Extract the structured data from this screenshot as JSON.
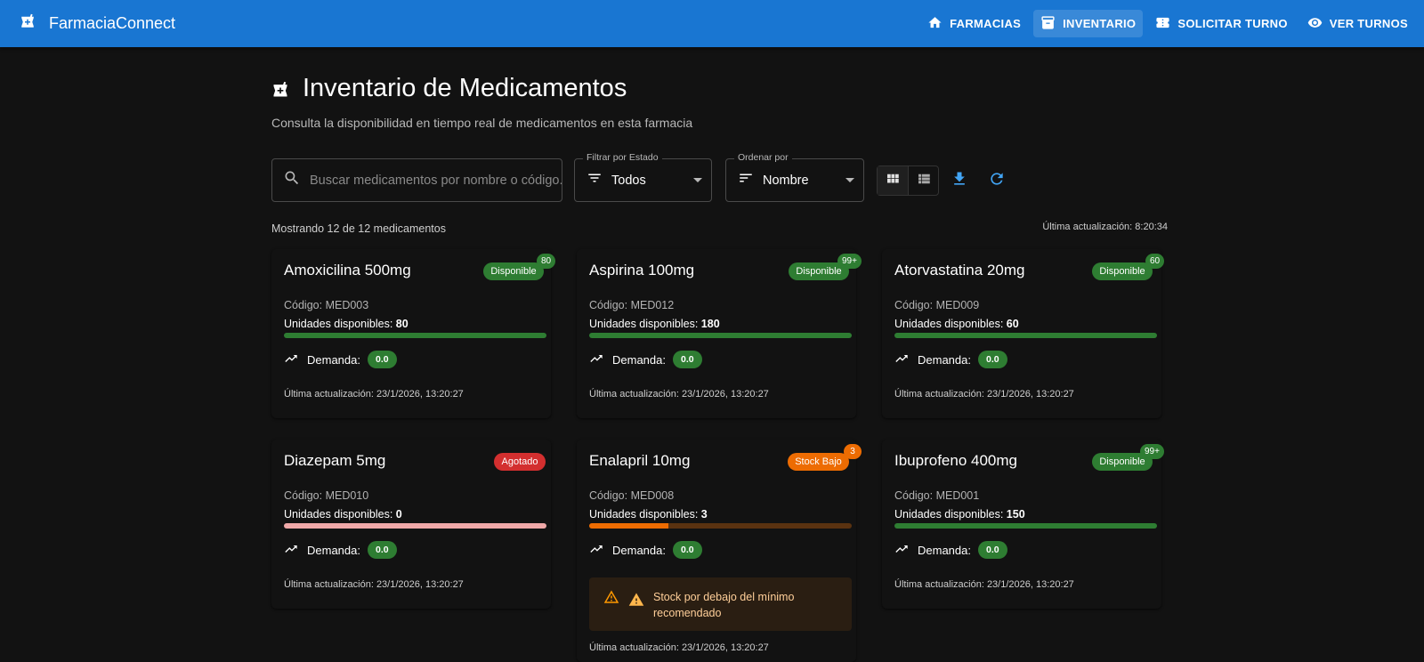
{
  "app": {
    "title": "FarmaciaConnect"
  },
  "nav": {
    "items": [
      {
        "label": "FARMACIAS",
        "icon": "home-icon"
      },
      {
        "label": "INVENTARIO",
        "icon": "inventory-icon",
        "active": true
      },
      {
        "label": "SOLICITAR TURNO",
        "icon": "ticket-icon"
      },
      {
        "label": "VER TURNOS",
        "icon": "eye-icon"
      }
    ]
  },
  "page": {
    "title": "Inventario de Medicamentos",
    "subtitle": "Consulta la disponibilidad en tiempo real de medicamentos en esta farmacia"
  },
  "controls": {
    "search_placeholder": "Buscar medicamentos por nombre o código...",
    "filter": {
      "label": "Filtrar por Estado",
      "value": "Todos"
    },
    "sort": {
      "label": "Ordenar por",
      "value": "Nombre"
    }
  },
  "summary": {
    "showing": "Mostrando 12 de 12 medicamentos",
    "last_update": "Última actualización: 8:20:34"
  },
  "labels": {
    "code_prefix": "Código:",
    "units_prefix": "Unidades disponibles:",
    "demand": "Demanda:",
    "updated_prefix": "Última actualización:"
  },
  "colors": {
    "appbar": "#1976d2",
    "available": "#2e7d32",
    "out_of_stock": "#d32f2f",
    "low_stock": "#ed6c02"
  },
  "cards": [
    {
      "name": "Amoxicilina 500mg",
      "status": "Disponible",
      "badge": "80",
      "code": "MED003",
      "units": "80",
      "demand": "0.0",
      "updated": "23/1/2026, 13:20:27",
      "stock_level": 1.0
    },
    {
      "name": "Aspirina 100mg",
      "status": "Disponible",
      "badge": "99+",
      "code": "MED012",
      "units": "180",
      "demand": "0.0",
      "updated": "23/1/2026, 13:20:27",
      "stock_level": 1.0
    },
    {
      "name": "Atorvastatina 20mg",
      "status": "Disponible",
      "badge": "60",
      "code": "MED009",
      "units": "60",
      "demand": "0.0",
      "updated": "23/1/2026, 13:20:27",
      "stock_level": 1.0
    },
    {
      "name": "Diazepam 5mg",
      "status": "Agotado",
      "badge": "",
      "code": "MED010",
      "units": "0",
      "demand": "0.0",
      "updated": "23/1/2026, 13:20:27",
      "stock_level": 0.0
    },
    {
      "name": "Enalapril 10mg",
      "status": "Stock Bajo",
      "badge": "3",
      "code": "MED008",
      "units": "3",
      "demand": "0.0",
      "updated": "23/1/2026, 13:20:27",
      "stock_level": 0.3,
      "alert": "Stock por debajo del mínimo recomendado"
    },
    {
      "name": "Ibuprofeno 400mg",
      "status": "Disponible",
      "badge": "99+",
      "code": "MED001",
      "units": "150",
      "demand": "0.0",
      "updated": "23/1/2026, 13:20:27",
      "stock_level": 1.0
    }
  ]
}
